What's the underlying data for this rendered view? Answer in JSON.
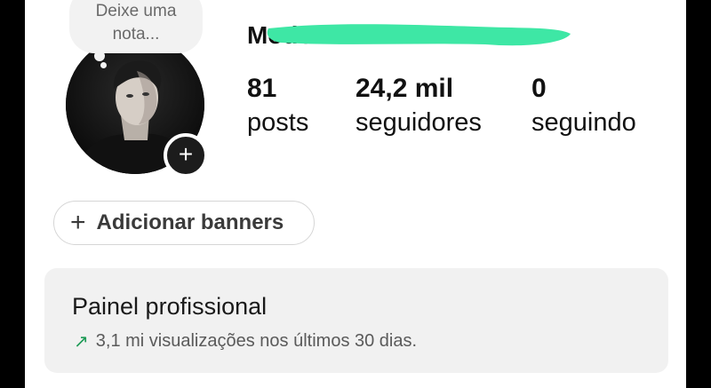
{
  "note": {
    "text_line1": "Deixe uma",
    "text_line2": "nota..."
  },
  "profile": {
    "username": "Modo Dea",
    "stats": [
      {
        "value": "81",
        "label": "posts"
      },
      {
        "value": "24,2 mil",
        "label": "seguidores"
      },
      {
        "value": "0",
        "label": "seguindo"
      }
    ]
  },
  "actions": {
    "add_banners_label": "Adicionar banners"
  },
  "dashboard": {
    "title": "Painel profissional",
    "trend_text": "3,1 mi visualizações nos últimos 30 dias."
  },
  "colors": {
    "redaction": "#3ee7a5",
    "trend_arrow": "#1e9b57"
  },
  "icons": {
    "add_story": "plus-circle-icon",
    "add_banner": "plus-icon",
    "trend": "trending-up-arrow-icon"
  }
}
